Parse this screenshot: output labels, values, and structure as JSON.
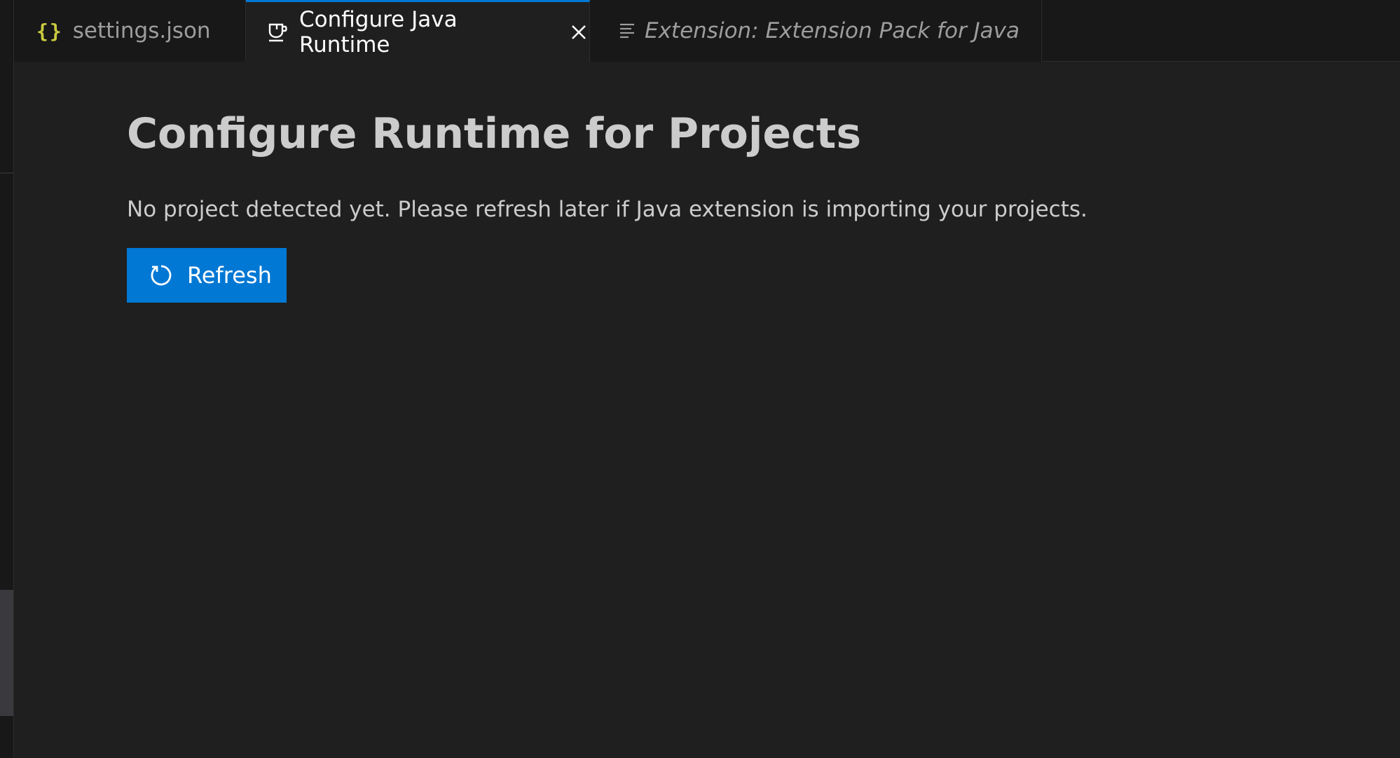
{
  "tabs": [
    {
      "label": "settings.json",
      "icon": "braces-icon",
      "glyph": "{}",
      "active": false,
      "italic": false
    },
    {
      "label": "Configure Java Runtime",
      "icon": "coffee-cup-icon",
      "active": true,
      "italic": false
    },
    {
      "label": "Extension: Extension Pack for Java",
      "icon": "preview-lines-icon",
      "active": false,
      "italic": true
    }
  ],
  "main": {
    "title": "Configure Runtime for Projects",
    "description": "No project detected yet. Please refresh later if Java extension is importing your projects.",
    "refresh_label": "Refresh"
  },
  "colors": {
    "accent": "#0078d4",
    "background": "#1f1f1f",
    "tabbar": "#181818",
    "braces": "#cbcb41"
  }
}
